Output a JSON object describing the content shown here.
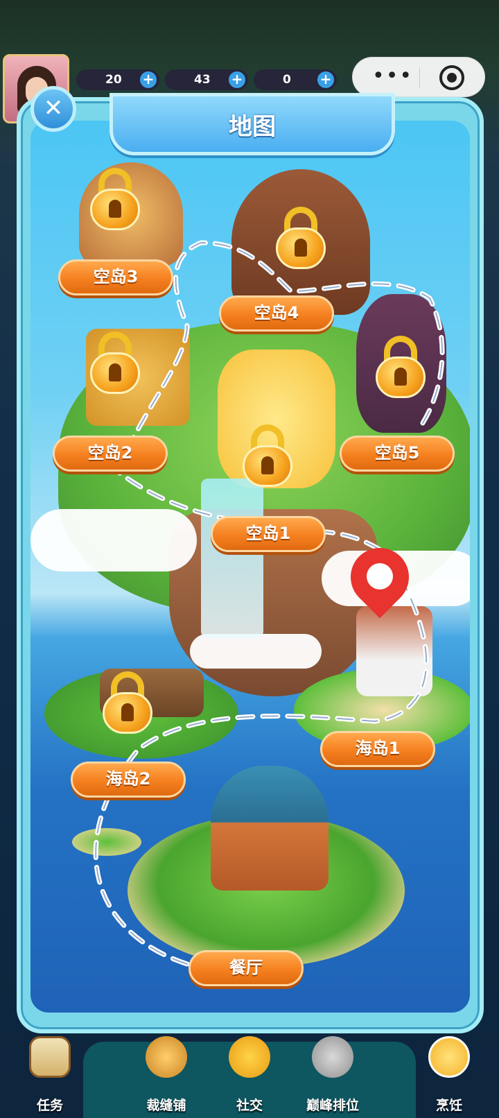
{
  "hud": {
    "energy": "20",
    "coins": "43",
    "gems": "0",
    "plus": "+"
  },
  "capsule": {
    "more_glyph": "•••"
  },
  "panel": {
    "title": "地图",
    "close_glyph": "✕"
  },
  "nodes": {
    "sky1": "空岛1",
    "sky2": "空岛2",
    "sky3": "空岛3",
    "sky4": "空岛4",
    "sky5": "空岛5",
    "sea1": "海岛1",
    "sea2": "海岛2",
    "restaurant": "餐厅"
  },
  "current_location": "海岛1",
  "nav": {
    "tasks": "任务",
    "tailor": "裁缝铺",
    "social": "社交",
    "ranking": "巅峰排位",
    "cooking": "烹饪"
  },
  "colors": {
    "label_orange": "#f5801f",
    "lock_gold": "#f6a21e",
    "pin_red": "#e8332f",
    "panel_blue": "#7ad7ea"
  }
}
